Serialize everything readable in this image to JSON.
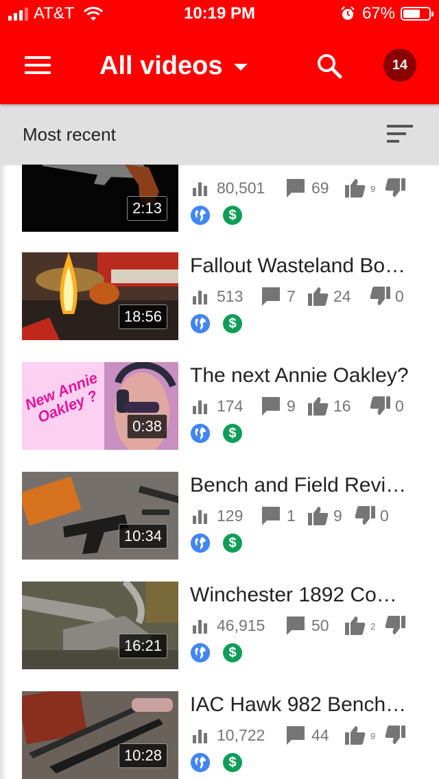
{
  "status_bar": {
    "carrier": "AT&T",
    "time": "10:19 PM",
    "battery_percent": "67%",
    "battery_level": 0.67
  },
  "app_bar": {
    "title": "All videos",
    "notification_count": "14",
    "accent_color": "#ff0000"
  },
  "sort_bar": {
    "label": "Most recent"
  },
  "videos": [
    {
      "title": "",
      "duration": "2:13",
      "views": "80,501",
      "comments": "69",
      "likes": "9",
      "dislikes": "",
      "thumb": "revolver"
    },
    {
      "title": "Fallout Wasteland Bo…",
      "duration": "18:56",
      "views": "513",
      "comments": "7",
      "likes": "24",
      "dislikes": "0",
      "thumb": "flame"
    },
    {
      "title": "The next Annie Oakley?",
      "duration": "0:38",
      "views": "174",
      "comments": "9",
      "likes": "16",
      "dislikes": "0",
      "thumb_text": "New Annie Oakley ?",
      "thumb": "annie"
    },
    {
      "title": "Bench and Field Revi…",
      "duration": "10:34",
      "views": "129",
      "comments": "1",
      "likes": "9",
      "dislikes": "0",
      "thumb": "pistol-parts"
    },
    {
      "title": "Winchester 1892 Co…",
      "duration": "16:21",
      "views": "46,915",
      "comments": "50",
      "likes": "2",
      "dislikes": "",
      "thumb": "pliers"
    },
    {
      "title": "IAC Hawk 982 Bench…",
      "duration": "10:28",
      "views": "10,722",
      "comments": "44",
      "likes": "9",
      "dislikes": "",
      "thumb": "shotgun"
    }
  ],
  "icons": {
    "views": "bar-chart-icon",
    "comments": "comment-icon",
    "likes": "thumbs-up-icon",
    "dislikes": "thumbs-down-icon",
    "visibility": "globe-icon",
    "monetized": "dollar-icon"
  }
}
